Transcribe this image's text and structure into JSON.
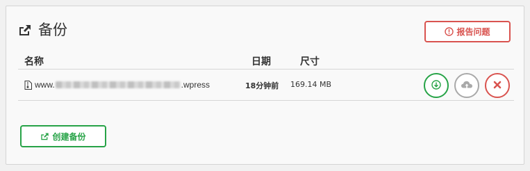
{
  "header": {
    "title": "备份",
    "icon": "share-export-icon",
    "report_button": {
      "label": "报告问题",
      "icon": "alert-circle-icon",
      "color": "#d9534f"
    }
  },
  "table": {
    "columns": {
      "name": "名称",
      "date": "日期",
      "size": "尺寸"
    },
    "rows": [
      {
        "file_prefix": "www.",
        "file_suffix": ".wpress",
        "date": "18分钟前",
        "size": "169.14 MB",
        "actions": [
          "download-icon",
          "cloud-restore-icon",
          "delete-icon"
        ]
      }
    ]
  },
  "create_button": {
    "label": "创建备份",
    "icon": "share-export-icon",
    "color": "#27a347"
  }
}
